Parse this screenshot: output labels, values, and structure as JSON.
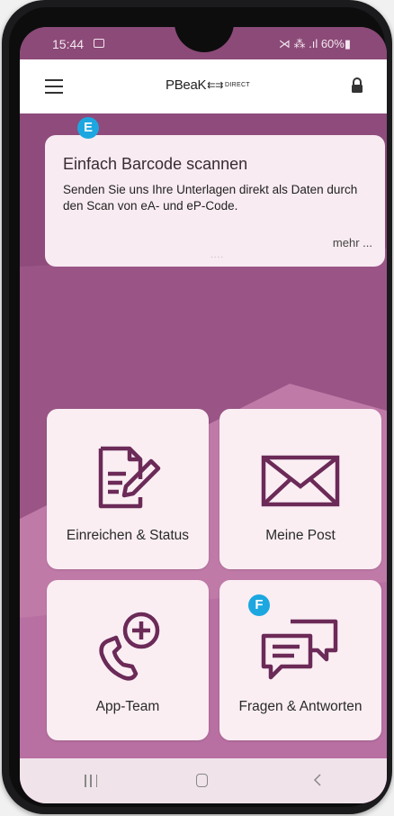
{
  "status_bar": {
    "time": "15:44",
    "signal_text": "⋊ ⁂ .ıl 60%▮"
  },
  "app_bar": {
    "logo_main": "PBeaK",
    "logo_arrows": "⇇⇉",
    "logo_suffix": "DIRECT"
  },
  "info_card": {
    "title": "Einfach Barcode scannen",
    "text": "Senden Sie uns Ihre Unterlagen direkt als Daten durch den Scan von eA- und eP-Code.",
    "more": "mehr ...",
    "pager": "....",
    "badge": "E"
  },
  "tiles": [
    {
      "label": "Einreichen & Status",
      "icon": "document-edit-icon"
    },
    {
      "label": "Meine Post",
      "icon": "envelope-icon"
    },
    {
      "label": "App-Team",
      "icon": "phone-plus-icon"
    },
    {
      "label": "Fragen & Antworten",
      "icon": "chat-bubbles-icon",
      "badge": "F"
    }
  ],
  "colors": {
    "primary": "#8c4a78",
    "tile_bg": "#faeef3",
    "badge": "#1da7e0"
  }
}
